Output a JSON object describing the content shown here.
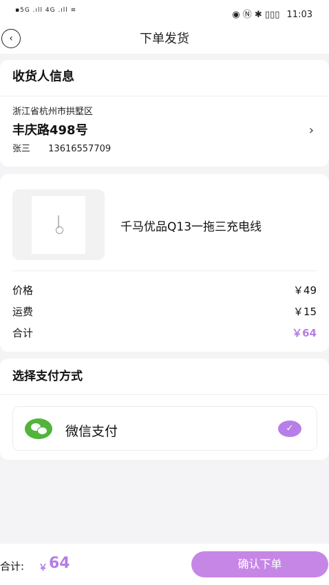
{
  "status_bar": {
    "left_indicators": "▪5G .ıll 4G .ıll ≋",
    "right_indicators": "◉ Ⓝ ✱ ▯▯▯",
    "time": "11:03"
  },
  "navbar": {
    "title": "下单发货",
    "back_icon": "chevron-left-circle-icon"
  },
  "address": {
    "section_title": "收货人信息",
    "region": "浙江省杭州市拱墅区",
    "street": "丰庆路498号",
    "name": "张三",
    "phone": "13616557709",
    "chevron": "›"
  },
  "order": {
    "product_name": "千马优品Q13一拖三充电线",
    "rows": [
      {
        "label": "价格",
        "value": "￥49"
      },
      {
        "label": "运费",
        "value": "￥15"
      },
      {
        "label": "合计",
        "value": "￥64"
      }
    ]
  },
  "payment": {
    "section_title": "选择支付方式",
    "method_label": "微信支付",
    "selected": true,
    "check_glyph": "✓"
  },
  "bottom_bar": {
    "total_label": "合计:",
    "currency": "￥",
    "total_value": "64",
    "confirm_label": "确认下单"
  },
  "colors": {
    "accent": "#b57de6",
    "button": "#c686e6",
    "wechat_green": "#52b43a",
    "background": "#f4f4f6"
  }
}
